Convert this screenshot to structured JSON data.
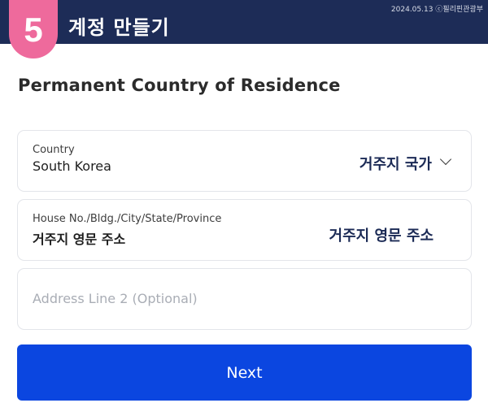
{
  "banner": {
    "step_number": "5",
    "title": "계정 만들기",
    "credit": "2024.05.13 ⓒ필리핀관광부"
  },
  "form": {
    "heading": "Permanent Country of Residence",
    "country": {
      "label": "Country",
      "value": "South Korea",
      "annotation": "거주지 국가",
      "icon": "chevron-down-icon"
    },
    "address": {
      "label": "House No./Bldg./City/State/Province",
      "value": "거주지 영문 주소",
      "annotation": "거주지 영문 주소"
    },
    "address_line2": {
      "placeholder": "Address Line 2 (Optional)"
    },
    "next_label": "Next"
  },
  "colors": {
    "banner": "#1d2c57",
    "step_tab": "#ee6a9c",
    "primary_button": "#0b46e0",
    "annotation_text": "#1b2a55"
  }
}
